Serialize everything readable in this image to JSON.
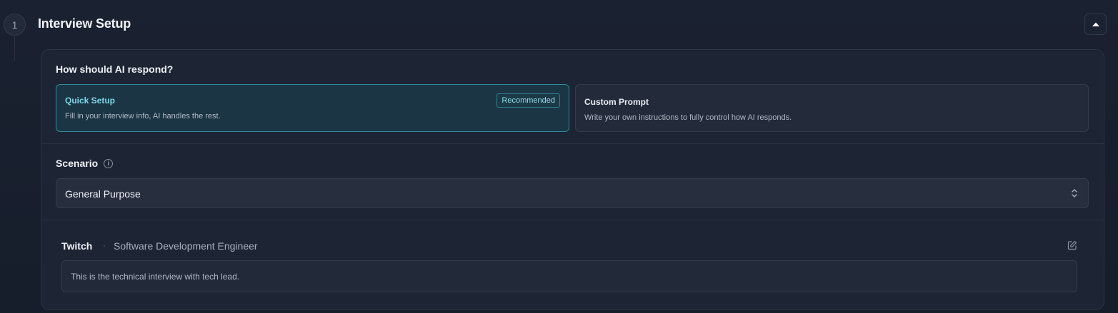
{
  "step": {
    "number": "1",
    "title": "Interview Setup",
    "collapse_icon": "caret-up-icon"
  },
  "response_mode": {
    "question": "How should AI respond?",
    "options": [
      {
        "title": "Quick Setup",
        "description": "Fill in your interview info, AI handles the rest.",
        "badge": "Recommended",
        "selected": true
      },
      {
        "title": "Custom Prompt",
        "description": "Write your own instructions to fully control how AI responds.",
        "selected": false
      }
    ]
  },
  "scenario": {
    "label": "Scenario",
    "info_icon": "info-icon",
    "selected": "General Purpose",
    "chevron_icon": "chevron-up-down-icon"
  },
  "interview": {
    "company": "Twitch",
    "separator": "·",
    "role": "Software Development Engineer",
    "edit_icon": "edit-icon",
    "notes": "This is the technical interview with tech lead."
  },
  "colors": {
    "accent": "#2d8aa0",
    "accent_text": "#7fd6ea",
    "background": "#171e2c",
    "card": "#1d2433"
  }
}
